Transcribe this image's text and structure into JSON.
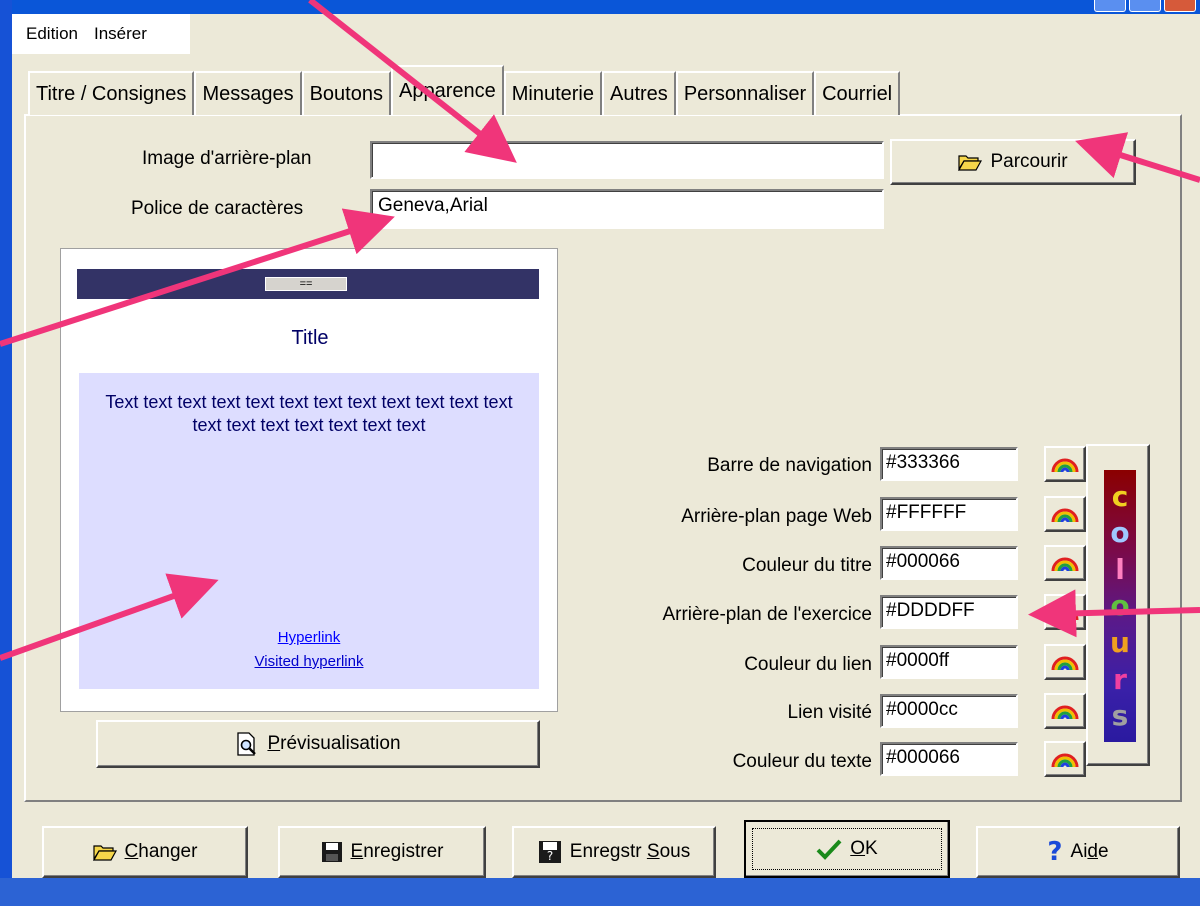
{
  "menu": {
    "items": [
      "Edition",
      "Insérer"
    ]
  },
  "tabs": [
    "Titre / Consignes",
    "Messages",
    "Boutons",
    "Apparence",
    "Minuterie",
    "Autres",
    "Personnaliser",
    "Courriel"
  ],
  "active_tab": "Apparence",
  "form": {
    "background_label": "Image d'arrière-plan",
    "background_value": "",
    "browse_label": "Parcourir",
    "font_label": "Police de caractères",
    "font_value": "Geneva,Arial"
  },
  "preview": {
    "nav_button": "==",
    "title": "Title",
    "text": "Text text text text text text text text text text text text text text text text text text text",
    "link": "Hyperlink",
    "visited_link": "Visited hyperlink",
    "preview_button": "Prévisualisation"
  },
  "colors": [
    {
      "label": "Barre de navigation",
      "value": "#333366"
    },
    {
      "label": "Arrière-plan page Web",
      "value": "#FFFFFF"
    },
    {
      "label": "Couleur du titre",
      "value": "#000066"
    },
    {
      "label": "Arrière-plan de l'exercice",
      "value": "#DDDDFF"
    },
    {
      "label": "Couleur du lien",
      "value": "#0000ff"
    },
    {
      "label": "Lien visité",
      "value": "#0000cc"
    },
    {
      "label": "Couleur du texte",
      "value": "#000066"
    }
  ],
  "colours_letters": [
    "c",
    "o",
    "l",
    "o",
    "u",
    "r",
    "s"
  ],
  "bottom_buttons": {
    "change": "Changer",
    "save": "Enregistrer",
    "save_as": "Enregstr Sous",
    "ok": "OK",
    "help": "Aide"
  },
  "annotation_color": "#f0357a"
}
